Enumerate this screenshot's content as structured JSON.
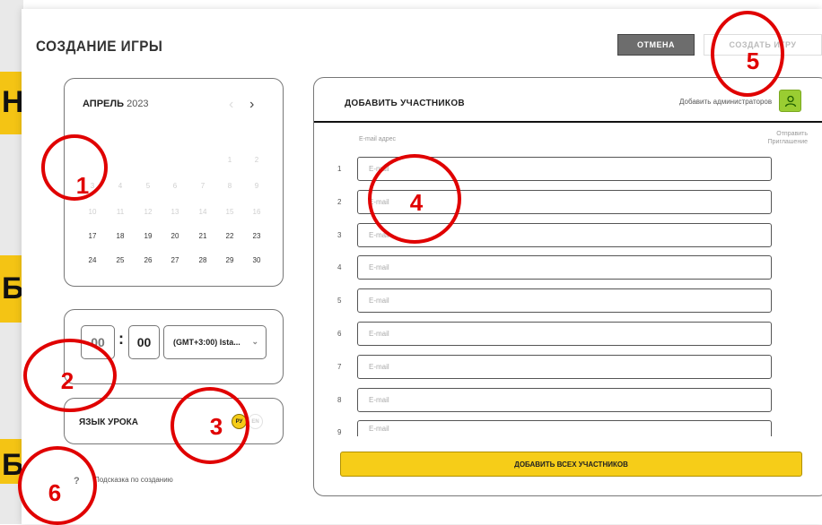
{
  "background": {
    "glyphs": [
      "H",
      "Б",
      "Б"
    ]
  },
  "header": {
    "title": "СОЗДАНИЕ ИГРЫ",
    "cancel_label": "ОТМЕНА",
    "create_label": "СОЗДАТЬ ИГРУ"
  },
  "calendar": {
    "month": "АПРЕЛЬ",
    "year": "2023",
    "prev_icon": "chevron-left-icon",
    "next_icon": "chevron-right-icon",
    "weekdays": [
      "",
      "",
      "",
      "",
      "",
      "",
      ""
    ],
    "weeks": [
      [
        "",
        "",
        "",
        "",
        "",
        "1",
        "2"
      ],
      [
        "3",
        "4",
        "5",
        "6",
        "7",
        "8",
        "9"
      ],
      [
        "10",
        "11",
        "12",
        "13",
        "14",
        "15",
        "16"
      ],
      [
        "17",
        "18",
        "19",
        "20",
        "21",
        "22",
        "23"
      ],
      [
        "24",
        "25",
        "26",
        "27",
        "28",
        "29",
        "30"
      ]
    ]
  },
  "time": {
    "hours": "00",
    "separator": ":",
    "minutes": "00",
    "timezone": "(GMT+3:00) Ista...",
    "dropdown_icon": "chevron-down-icon"
  },
  "language": {
    "label": "ЯЗЫК УРОКА",
    "options": [
      "РУ",
      "EN"
    ],
    "selected": "РУ"
  },
  "hint": {
    "icon": "question-icon",
    "text": "Подсказка по созданию"
  },
  "participants": {
    "title": "ДОБАВИТЬ УЧАСТНИКОВ",
    "add_admin": "Добавить администраторов",
    "admin_icon": "user-icon",
    "col_email": "E-mail адрес",
    "col_send": "Отправить Приглашение",
    "rows": [
      {
        "num": "1",
        "placeholder": "E-mail"
      },
      {
        "num": "2",
        "placeholder": "E-mail"
      },
      {
        "num": "3",
        "placeholder": "E-mail"
      },
      {
        "num": "4",
        "placeholder": "E-mail"
      },
      {
        "num": "5",
        "placeholder": "E-mail"
      },
      {
        "num": "6",
        "placeholder": "E-mail"
      },
      {
        "num": "7",
        "placeholder": "E-mail"
      },
      {
        "num": "8",
        "placeholder": "E-mail"
      },
      {
        "num": "9",
        "placeholder": "E-mail"
      }
    ],
    "add_all": "ДОБАВИТЬ ВСЕХ УЧАСТНИКОВ"
  },
  "annotations": [
    "1",
    "2",
    "3",
    "4",
    "5",
    "6"
  ],
  "colors": {
    "accent": "#f6cd18",
    "annotation": "#e00000",
    "admin_button": "#9acd32"
  }
}
